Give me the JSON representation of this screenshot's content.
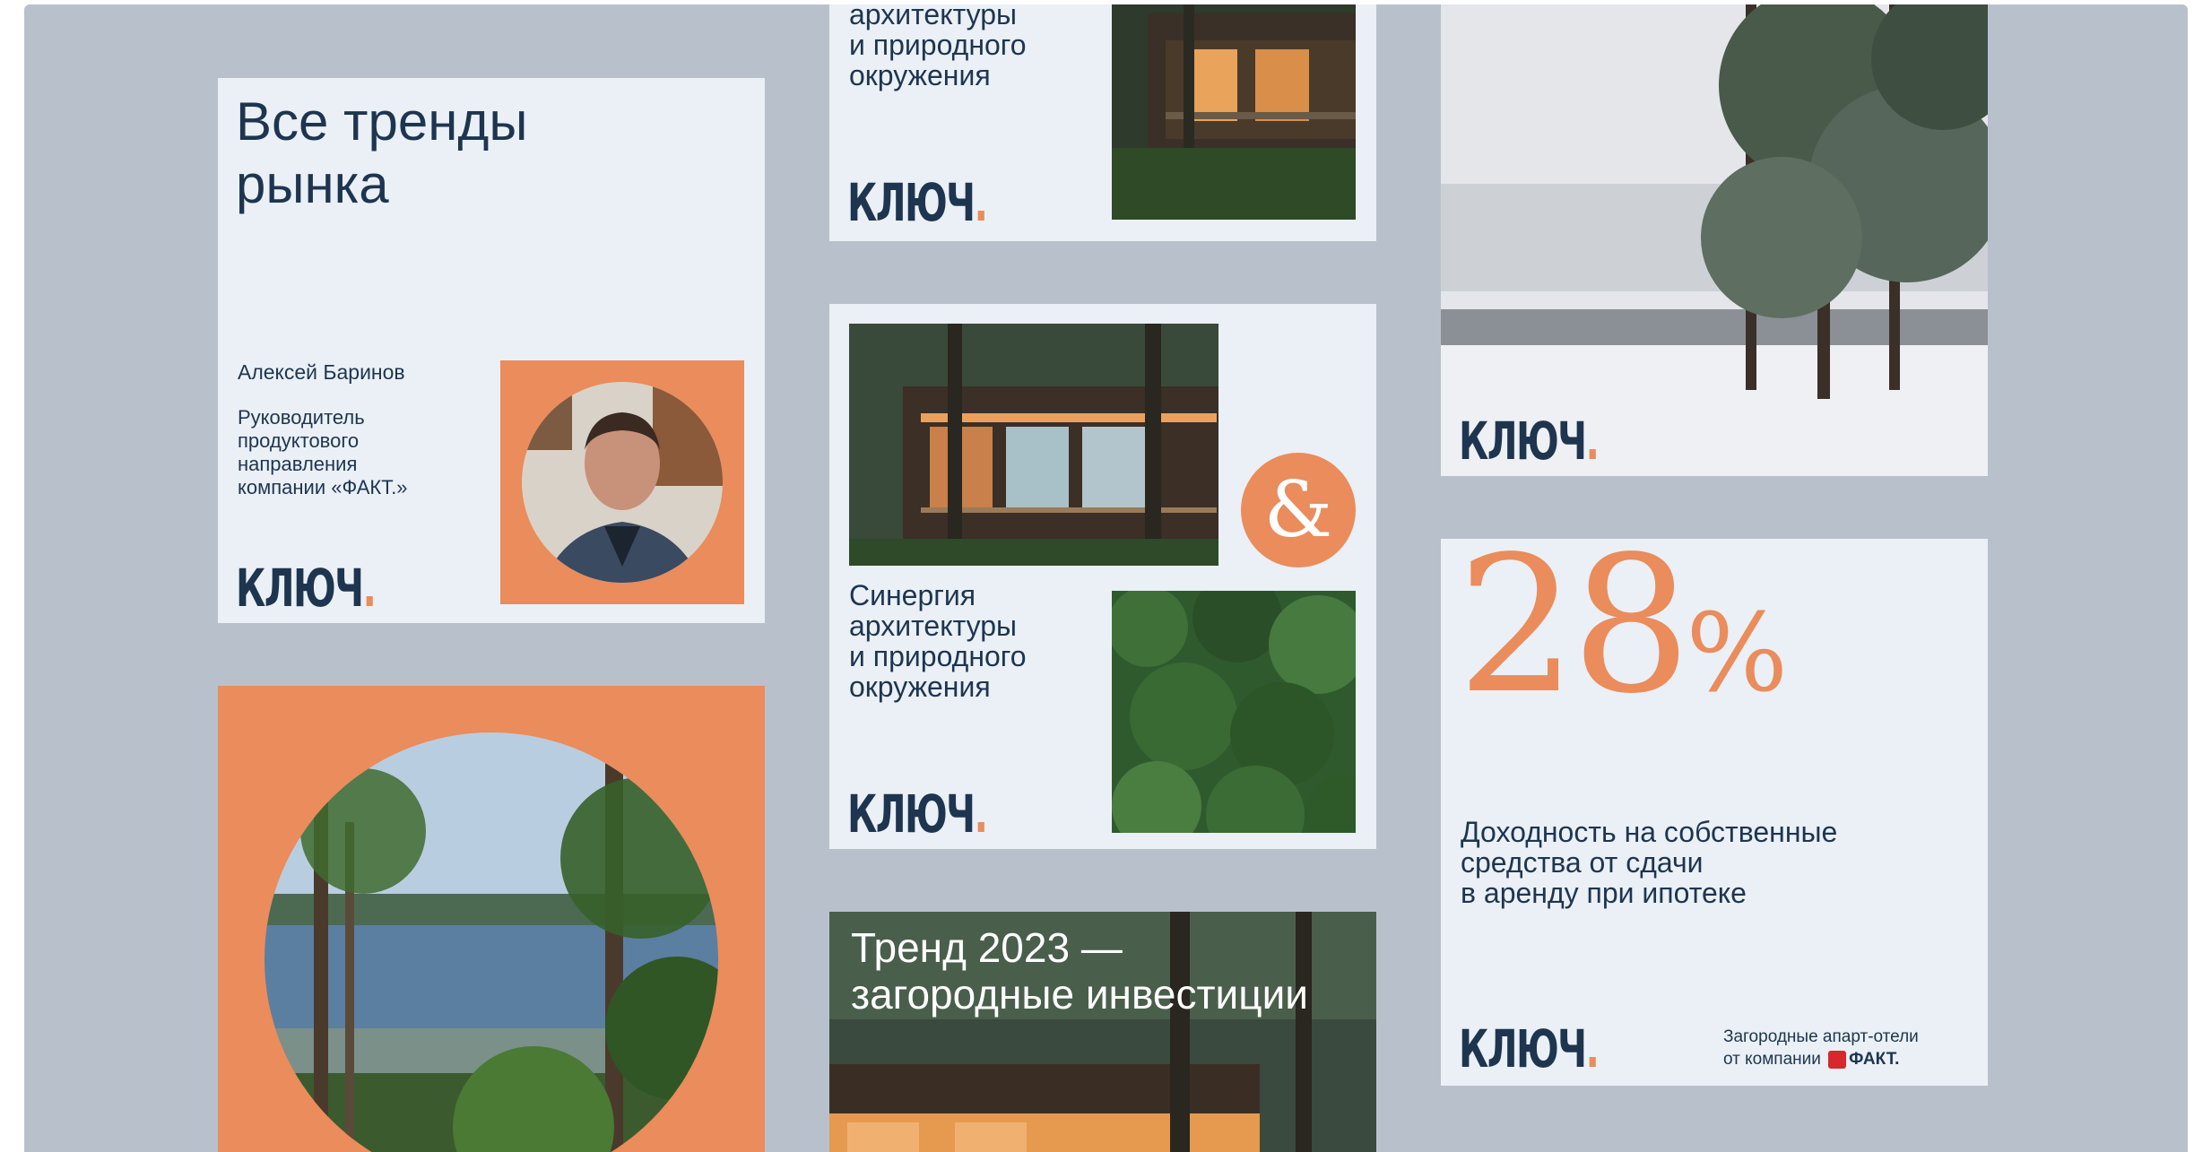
{
  "brand": {
    "logo_text": "КЛЮЧ",
    "logo_dot": "."
  },
  "colors": {
    "background": "#b8c1cb",
    "card": "#eaf0f5",
    "accent": "#ea8c5b",
    "navy": "#1e3550"
  },
  "card_trends": {
    "title_line1": "Все тренды",
    "title_line2": "рынка",
    "person_name": "Алексей Баринов",
    "person_role_lines": [
      "Руководитель",
      "продуктового",
      "направления",
      "компании «ФАКТ.»"
    ]
  },
  "card_top_partial": {
    "lines": [
      "архитектуры",
      "и природного",
      "окружения"
    ]
  },
  "card_synergy": {
    "ampersand": "&",
    "lines": [
      "Синергия",
      "архитектуры",
      "и природного",
      "окружения"
    ]
  },
  "card_trend2023": {
    "line1": "Тренд 2023 —",
    "line2": "загородные инвестиции"
  },
  "card_yield": {
    "number": "28",
    "percent": "%",
    "lines": [
      "Доходность на собственные",
      "средства от сдачи",
      "в аренду при ипотеке"
    ],
    "footer_line1": "Загородные апарт-отели",
    "footer_line2": "от компании",
    "fact_brand": "ФАКТ."
  },
  "icons": [
    "photo-forest-house",
    "photo-winter-lake",
    "photo-lake-circle",
    "photo-pine-canopy",
    "portrait-photo"
  ]
}
